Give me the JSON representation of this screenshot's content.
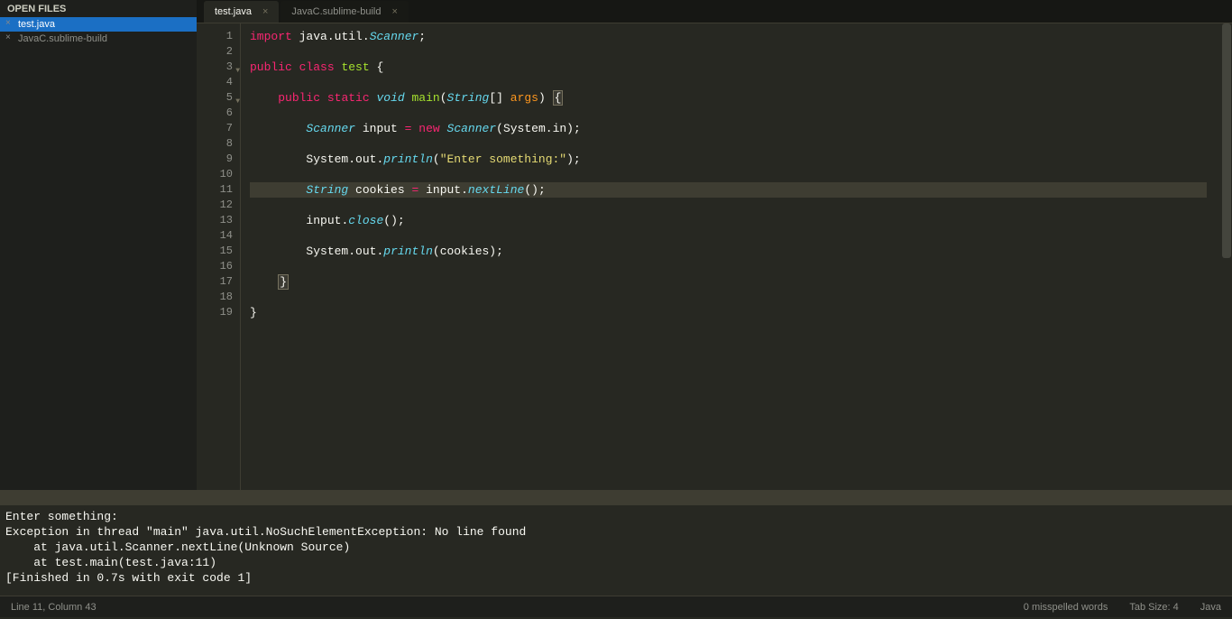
{
  "sidebar": {
    "header": "OPEN FILES",
    "files": [
      {
        "name": "test.java",
        "active": true
      },
      {
        "name": "JavaC.sublime-build",
        "active": false
      }
    ]
  },
  "tabs": [
    {
      "label": "test.java",
      "active": true
    },
    {
      "label": "JavaC.sublime-build",
      "active": false
    }
  ],
  "gutter": {
    "lines": [
      1,
      2,
      3,
      4,
      5,
      6,
      7,
      8,
      9,
      10,
      11,
      12,
      13,
      14,
      15,
      16,
      17,
      18,
      19
    ],
    "current_line": 11,
    "dots": [
      5,
      17
    ],
    "folds": [
      3,
      5
    ]
  },
  "code": {
    "raw": "import java.util.Scanner;\n\npublic class test {\n\n    public static void main(String[] args) {\n\n        Scanner input = new Scanner(System.in);\n\n        System.out.println(\"Enter something:\");\n\n        String cookies = input.nextLine();\n\n        input.close();\n\n        System.out.println(cookies);\n\n    }\n\n}"
  },
  "console": {
    "lines": [
      "Enter something:",
      "Exception in thread \"main\" java.util.NoSuchElementException: No line found",
      "    at java.util.Scanner.nextLine(Unknown Source)",
      "    at test.main(test.java:11)",
      "[Finished in 0.7s with exit code 1]"
    ]
  },
  "status": {
    "position": "Line 11, Column 43",
    "spell": "0 misspelled words",
    "tab_size": "Tab Size: 4",
    "language": "Java"
  }
}
